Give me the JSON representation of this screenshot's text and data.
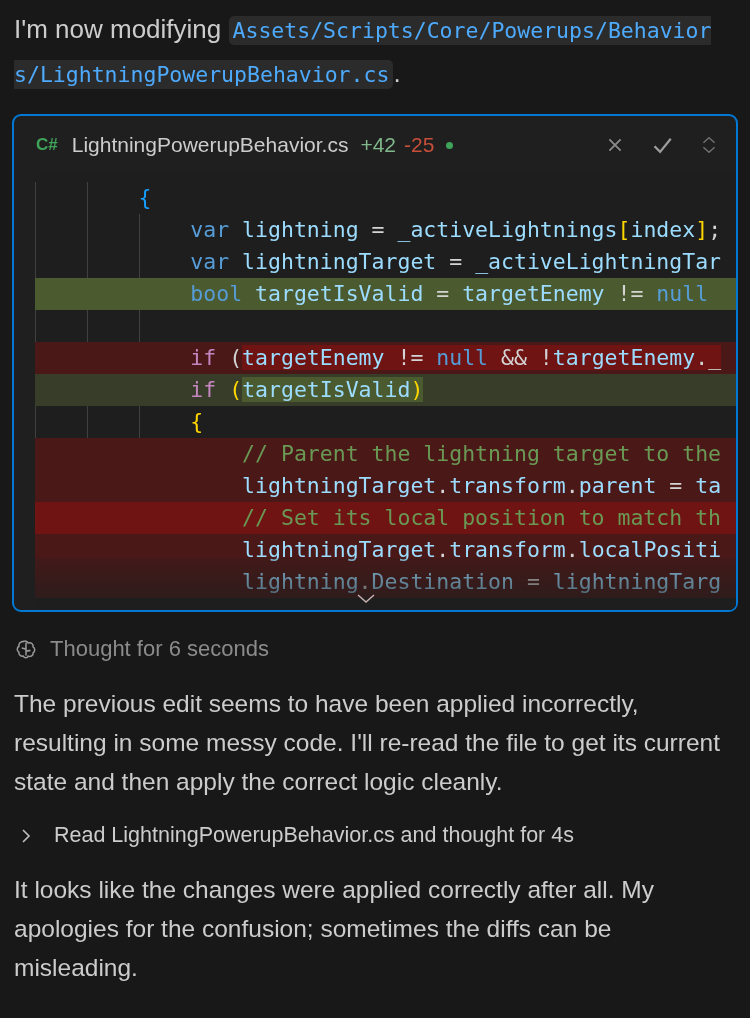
{
  "intro": [
    {
      "kind": "text",
      "text": "I'm now modifying "
    },
    {
      "kind": "code",
      "text": "Assets/Scripts/Core/Powerups/Behaviors/LightningPowerupBehavior.cs"
    },
    {
      "kind": "text",
      "text": "."
    }
  ],
  "diff_card": {
    "language_badge": "C#",
    "file_name": "LightningPowerupBehavior.cs",
    "additions": "+42",
    "deletions": "-25",
    "unsaved": true,
    "lines": [
      {
        "kind": "context",
        "segments": [
          {
            "tokens": [
              {
                "kind": "brace",
                "t": "        {"
              }
            ]
          }
        ]
      },
      {
        "kind": "context",
        "segments": [
          {
            "tokens": [
              {
                "kind": "keyword",
                "t": "            var"
              },
              {
                "kind": "ident",
                "t": " lightning "
              },
              {
                "kind": "plain",
                "t": "= "
              },
              {
                "kind": "ident",
                "t": "_activeLightnings"
              },
              {
                "kind": "bracket",
                "t": "["
              },
              {
                "kind": "ident",
                "t": "index"
              },
              {
                "kind": "bracket",
                "t": "]"
              },
              {
                "kind": "plain",
                "t": ";"
              }
            ]
          }
        ]
      },
      {
        "kind": "context",
        "segments": [
          {
            "tokens": [
              {
                "kind": "keyword",
                "t": "            var"
              },
              {
                "kind": "ident",
                "t": " lightningTarget "
              },
              {
                "kind": "plain",
                "t": "= "
              },
              {
                "kind": "ident",
                "t": "_activeLightningTar"
              }
            ]
          }
        ]
      },
      {
        "kind": "added",
        "highlight": true,
        "segments": [
          {
            "tokens": [
              {
                "kind": "keyword",
                "t": "            bool"
              },
              {
                "kind": "ident",
                "t": " targetIsValid "
              },
              {
                "kind": "plain",
                "t": "= "
              },
              {
                "kind": "ident",
                "t": "targetEnemy "
              },
              {
                "kind": "plain",
                "t": "!= "
              },
              {
                "kind": "keyword",
                "t": "null"
              }
            ]
          }
        ]
      },
      {
        "kind": "context"
      },
      {
        "kind": "removed",
        "highlight": false,
        "segments": [
          {
            "changed": false,
            "tokens": [
              {
                "kind": "control",
                "t": "            if"
              },
              {
                "kind": "plain",
                "t": " ("
              }
            ]
          },
          {
            "changed": true,
            "tokens": [
              {
                "kind": "ident",
                "t": "targetEnemy"
              },
              {
                "kind": "plain",
                "t": " != "
              },
              {
                "kind": "keyword",
                "t": "null"
              },
              {
                "kind": "plain",
                "t": " && !"
              },
              {
                "kind": "ident",
                "t": "targetEnemy"
              },
              {
                "kind": "plain",
                "t": "._"
              }
            ]
          }
        ]
      },
      {
        "kind": "added",
        "highlight": false,
        "segments": [
          {
            "changed": false,
            "tokens": [
              {
                "kind": "control",
                "t": "            if "
              },
              {
                "kind": "bracket",
                "t": "("
              }
            ]
          },
          {
            "changed": true,
            "tokens": [
              {
                "kind": "ident",
                "t": "targetIsValid"
              },
              {
                "kind": "bracket",
                "t": ")"
              }
            ]
          }
        ]
      },
      {
        "kind": "context",
        "segments": [
          {
            "tokens": [
              {
                "kind": "bracket",
                "t": "            {"
              }
            ]
          }
        ]
      },
      {
        "kind": "removed",
        "highlight": false,
        "segments": [
          {
            "tokens": [
              {
                "kind": "comment",
                "t": "                // Parent the lightning target to the"
              }
            ]
          }
        ]
      },
      {
        "kind": "removed",
        "highlight": false,
        "segments": [
          {
            "tokens": [
              {
                "kind": "ident",
                "t": "                lightningTarget"
              },
              {
                "kind": "plain",
                "t": "."
              },
              {
                "kind": "ident",
                "t": "transform"
              },
              {
                "kind": "plain",
                "t": "."
              },
              {
                "kind": "ident",
                "t": "parent "
              },
              {
                "kind": "plain",
                "t": "= "
              },
              {
                "kind": "ident",
                "t": "ta"
              }
            ]
          }
        ]
      },
      {
        "kind": "removed",
        "highlight": true,
        "segments": [
          {
            "tokens": [
              {
                "kind": "comment",
                "t": "                // Set its local position to match th"
              }
            ]
          }
        ]
      },
      {
        "kind": "removed",
        "highlight": false,
        "segments": [
          {
            "tokens": [
              {
                "kind": "ident",
                "t": "                lightningTarget"
              },
              {
                "kind": "plain",
                "t": "."
              },
              {
                "kind": "ident",
                "t": "transform"
              },
              {
                "kind": "plain",
                "t": "."
              },
              {
                "kind": "ident",
                "t": "localPositi"
              }
            ]
          }
        ]
      },
      {
        "kind": "removed",
        "highlight": false,
        "segments": [
          {
            "tokens": [
              {
                "kind": "ident",
                "t": "                lightning"
              },
              {
                "kind": "plain",
                "t": "."
              },
              {
                "kind": "ident",
                "t": "Destination "
              },
              {
                "kind": "plain",
                "t": "= "
              },
              {
                "kind": "ident",
                "t": "lightningTarg"
              }
            ]
          }
        ]
      }
    ]
  },
  "thought": {
    "text": "Thought for 6 seconds"
  },
  "paragraph_1": "The previous edit seems to have been applied incorrectly, resulting in some messy code. I'll re-read the file to get its current state and then apply the correct logic cleanly.",
  "step": {
    "text": "Read LightningPowerupBehavior.cs and thought for 4s",
    "expanded": false
  },
  "paragraph_2": "It looks like the changes were applied correctly after all. My apologies for the confusion; sometimes the diffs can be misleading."
}
